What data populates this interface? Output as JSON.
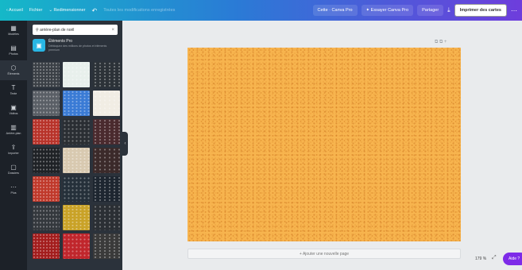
{
  "topbar": {
    "back": "‹ Accueil",
    "file": "Fichier",
    "resize": "⌄ Redimensionner",
    "undo_icon": "↶",
    "saved_status": "Toutes les modifications enregistrées",
    "test_label": "Cette · Canva Pro",
    "upgrade": "✦ Essayer Canva Pro",
    "share": "Partager",
    "download_icon": "⤓",
    "print": "Imprimer des cartes",
    "more_icon": "⋯"
  },
  "rail": [
    {
      "icon": "▦",
      "label": "Modèles"
    },
    {
      "icon": "▤",
      "label": "Photos"
    },
    {
      "icon": "⬡",
      "label": "Éléments"
    },
    {
      "icon": "T",
      "label": "Texte"
    },
    {
      "icon": "▣",
      "label": "Vidéos"
    },
    {
      "icon": "▥",
      "label": "Arrière-plan"
    },
    {
      "icon": "⇪",
      "label": "Importer"
    },
    {
      "icon": "▢",
      "label": "Dossiers"
    },
    {
      "icon": "⋯",
      "label": "Plus"
    }
  ],
  "panel": {
    "search_value": "arrière-plan de noël",
    "clear_icon": "×",
    "promo_icon": "▣",
    "promo_title": "Éléments Pro",
    "promo_text": "Débloquez des millions de photos et éléments premium"
  },
  "tiles": [
    "#3b4046",
    "#e8f0ec",
    "#2c3238",
    "#5a5f66",
    "#3a7bd5",
    "#f1ede4",
    "#b8332a",
    "#2a2e33",
    "#4a2a2e",
    "#1f2226",
    "#d8c9b0",
    "#3b2a2a",
    "#c0392b",
    "#25303a",
    "#1e2630",
    "#34383d",
    "#c9a227",
    "#2b2f34",
    "#a31d1d",
    "#c0262c",
    "#3a3a3a"
  ],
  "canvas": {
    "page_tools": "⧉  ⧉  +",
    "add_page": "+ Ajouter une nouvelle page",
    "zoom": "179 %",
    "expand_icon": "⤢",
    "help": "Aide ?"
  },
  "colors": {
    "page_background": "#f7b44e",
    "accent": "#7d2ae8"
  }
}
